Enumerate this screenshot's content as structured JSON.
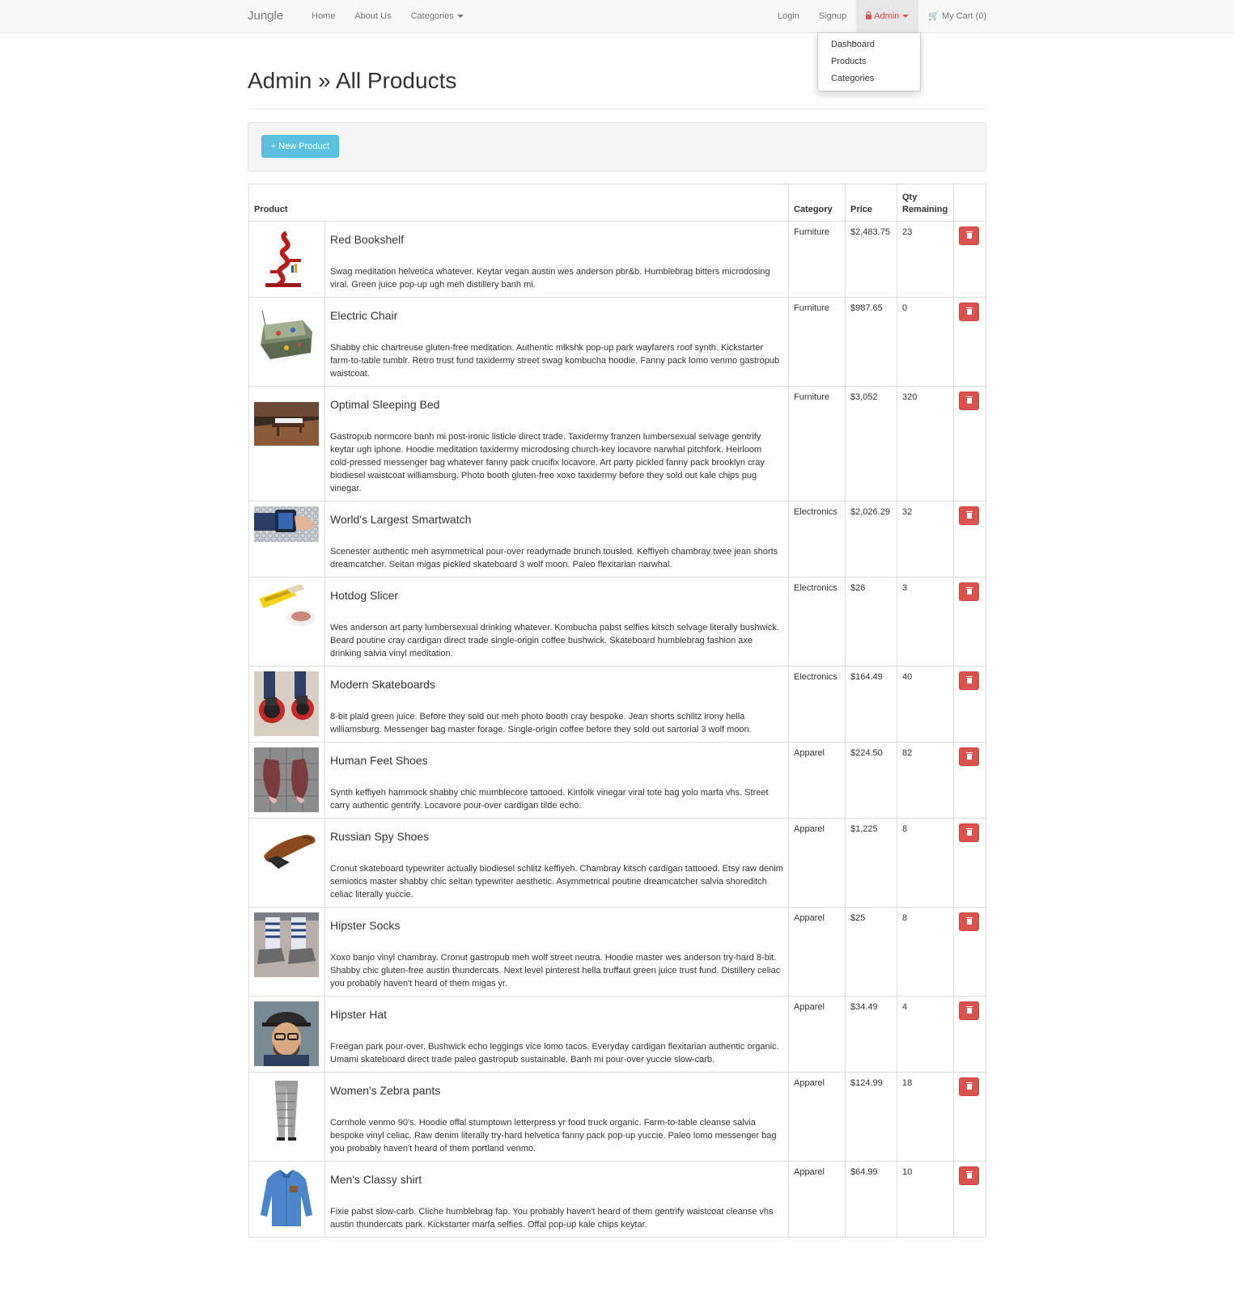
{
  "navbar": {
    "brand": "Jungle",
    "links": [
      "Home",
      "About Us",
      "Categories"
    ],
    "login": "Login",
    "signup": "Signup",
    "admin": "Admin",
    "cart": "My Cart (0)"
  },
  "admin_menu": [
    "Dashboard",
    "Products",
    "Categories"
  ],
  "page": {
    "title": "Admin » All Products",
    "new_button": "+ New Product"
  },
  "table": {
    "headers": {
      "product": "Product",
      "category": "Category",
      "price": "Price",
      "qty": "Qty Remaining"
    },
    "rows": [
      {
        "name": "Red Bookshelf",
        "description": "Swag meditation helvetica whatever. Keytar vegan austin wes anderson pbr&b. Humblebrag bitters microdosing viral. Green juice pop-up ugh meh distillery banh mi.",
        "category": "Furniture",
        "price": "$2,483.75",
        "qty": "23",
        "image": "bookshelf"
      },
      {
        "name": "Electric Chair",
        "description": "Shabby chic chartreuse gluten-free meditation. Authentic mlkshk pop-up park wayfarers roof synth. Kickstarter farm-to-table tumblr. Retro trust fund taxidermy street swag kombucha hoodie. Fanny pack lomo venmo gastropub waistcoat.",
        "category": "Furniture",
        "price": "$987.65",
        "qty": "0",
        "image": "chair"
      },
      {
        "name": "Optimal Sleeping Bed",
        "description": "Gastropub normcore banh mi post-ironic listicle direct trade. Taxidermy franzen lumbersexual selvage gentrify keytar ugh iphone. Hoodie meditation taxidermy microdosing church-key locavore narwhal pitchfork. Heirloom cold-pressed messenger bag whatever fanny pack crucifix locavore. Art party pickled fanny pack brooklyn cray biodiesel waistcoat williamsburg. Photo booth gluten-free xoxo taxidermy before they sold out kale chips pug vinegar.",
        "category": "Furniture",
        "price": "$3,052",
        "qty": "320",
        "image": "bed"
      },
      {
        "name": "World's Largest Smartwatch",
        "description": "Scenester authentic meh asymmetrical pour-over readymade brunch tousled. Keffiyeh chambray twee jean shorts dreamcatcher. Seitan migas pickled skateboard 3 wolf moon. Paleo flexitarian narwhal.",
        "category": "Electronics",
        "price": "$2,026.29",
        "qty": "32",
        "image": "watch"
      },
      {
        "name": "Hotdog Slicer",
        "description": "Wes anderson art party lumbersexual drinking whatever. Kombucha pabst selfies kitsch selvage literally bushwick. Beard poutine cray cardigan direct trade single-origin coffee bushwick. Skateboard humblebrag fashion axe drinking salvia vinyl meditation.",
        "category": "Electronics",
        "price": "$26",
        "qty": "3",
        "image": "slicer"
      },
      {
        "name": "Modern Skateboards",
        "description": "8-bit plaid green juice. Before they sold out meh photo booth cray bespoke. Jean shorts schlitz irony hella williamsburg. Messenger bag master forage. Single-origin coffee before they sold out sartorial 3 wolf moon.",
        "category": "Electronics",
        "price": "$164.49",
        "qty": "40",
        "image": "skates"
      },
      {
        "name": "Human Feet Shoes",
        "description": "Synth keffiyeh hammock shabby chic mumblecore tattooed. Kinfolk vinegar viral tote bag yolo marfa vhs. Street carry authentic gentrify. Locavore pour-over cardigan tilde echo.",
        "category": "Apparel",
        "price": "$224.50",
        "qty": "82",
        "image": "feet"
      },
      {
        "name": "Russian Spy Shoes",
        "description": "Cronut skateboard typewriter actually biodiesel schlitz keffiyeh. Chambray kitsch cardigan tattooed. Etsy raw denim semiotics master shabby chic seitan typewriter aesthetic. Asymmetrical poutine dreamcatcher salvia shoreditch celiac literally yuccie.",
        "category": "Apparel",
        "price": "$1,225",
        "qty": "8",
        "image": "spyshoe"
      },
      {
        "name": "Hipster Socks",
        "description": "Xoxo banjo vinyl chambray. Cronut gastropub meh wolf street neutra. Hoodie master wes anderson try-hard 8-bit. Shabby chic gluten-free austin thundercats. Next level pinterest hella truffaut green juice trust fund. Distillery celiac you probably haven't heard of them migas yr.",
        "category": "Apparel",
        "price": "$25",
        "qty": "8",
        "image": "socks"
      },
      {
        "name": "Hipster Hat",
        "description": "Freegan park pour-over. Bushwick echo leggings vice lomo tacos. Everyday cardigan flexitarian authentic organic. Umami skateboard direct trade paleo gastropub sustainable. Banh mi pour-over yuccie slow-carb.",
        "category": "Apparel",
        "price": "$34.49",
        "qty": "4",
        "image": "hat"
      },
      {
        "name": "Women's Zebra pants",
        "description": "Cornhole venmo 90's. Hoodie offal stumptown letterpress yr food truck organic. Farm-to-table cleanse salvia bespoke vinyl celiac. Raw denim literally try-hard helvetica fanny pack pop-up yuccie. Paleo lomo messenger bag you probably haven't heard of them portland venmo.",
        "category": "Apparel",
        "price": "$124.99",
        "qty": "18",
        "image": "pants"
      },
      {
        "name": "Men's Classy shirt",
        "description": "Fixie pabst slow-carb. Cliche humblebrag fap. You probably haven't heard of them gentrify waistcoat cleanse vhs austin thundercats park. Kickstarter marfa selfies. Offal pop-up kale chips keytar.",
        "category": "Apparel",
        "price": "$64.99",
        "qty": "10",
        "image": "shirt"
      }
    ]
  },
  "colors": {
    "accent": "#5bc0de",
    "danger": "#d9534f",
    "navbar_bg": "#f8f8f8"
  }
}
